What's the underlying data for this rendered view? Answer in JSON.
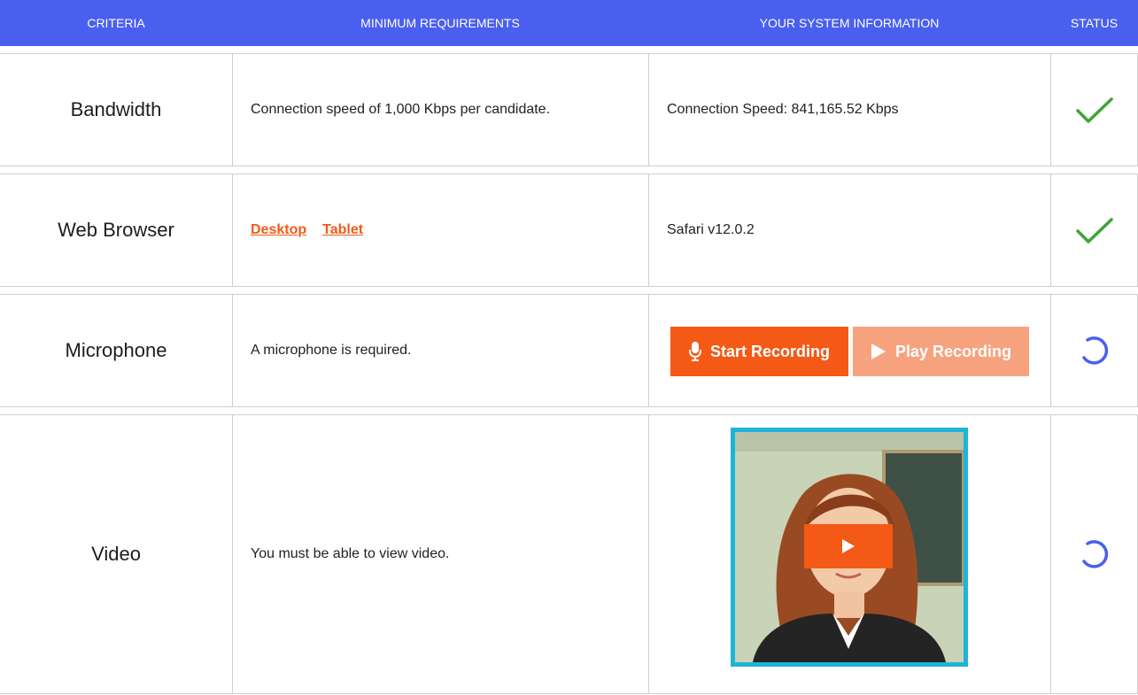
{
  "header": {
    "criteria": "CRITERIA",
    "minimum_requirements": "MINIMUM REQUIREMENTS",
    "system_info": "YOUR SYSTEM INFORMATION",
    "status": "STATUS"
  },
  "rows": {
    "bandwidth": {
      "criteria": "Bandwidth",
      "requirement": "Connection speed of 1,000 Kbps per candidate.",
      "system_info": "Connection Speed: 841,165.52 Kbps",
      "status_icon": "checkmark-icon"
    },
    "browser": {
      "criteria": "Web Browser",
      "links": [
        "Desktop",
        "Tablet"
      ],
      "system_info": "Safari v12.0.2",
      "status_icon": "checkmark-icon"
    },
    "microphone": {
      "criteria": "Microphone",
      "requirement": "A microphone is required.",
      "start_button": "Start Recording",
      "play_button": "Play Recording",
      "status_icon": "spinner-icon"
    },
    "video": {
      "criteria": "Video",
      "requirement": "You must be able to view video.",
      "status_icon": "spinner-icon"
    }
  },
  "colors": {
    "header_bg": "#4a5ff0",
    "accent_orange": "#f45a16",
    "accent_orange_light": "#f7a27f",
    "check_green": "#3fa535",
    "spinner_blue": "#4a5ff0",
    "video_border": "#1eb4d8"
  }
}
